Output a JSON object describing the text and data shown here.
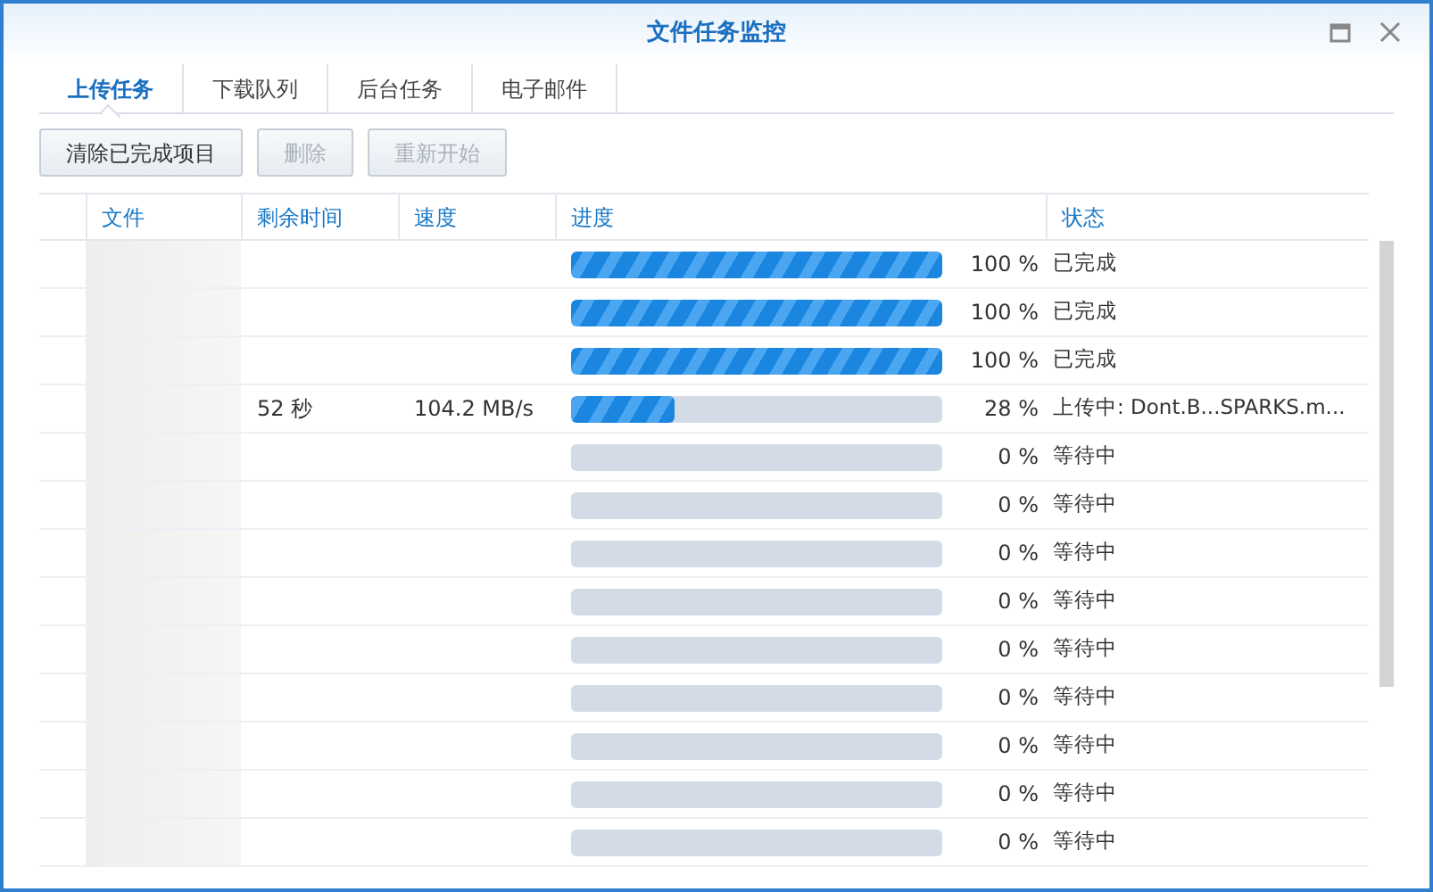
{
  "window": {
    "title": "文件任务监控"
  },
  "tabs": [
    {
      "label": "上传任务",
      "selected": true
    },
    {
      "label": "下载队列",
      "selected": false
    },
    {
      "label": "后台任务",
      "selected": false
    },
    {
      "label": "电子邮件",
      "selected": false
    }
  ],
  "toolbar": [
    {
      "label": "清除已完成项目",
      "disabled": false
    },
    {
      "label": "删除",
      "disabled": true
    },
    {
      "label": "重新开始",
      "disabled": true
    }
  ],
  "table": {
    "columns": [
      "文件",
      "剩余时间",
      "速度",
      "进度",
      "状态"
    ],
    "rows": [
      {
        "time_left": "",
        "speed": "",
        "level": 1,
        "percent": "100 %",
        "status": "已完成"
      },
      {
        "time_left": "",
        "speed": "",
        "level": 1,
        "percent": "100 %",
        "status": "已完成"
      },
      {
        "time_left": "",
        "speed": "",
        "level": 1,
        "percent": "100 %",
        "status": "已完成"
      },
      {
        "time_left": "52 秒",
        "speed": "104.2 MB/s",
        "level": 0.28,
        "percent": "28 %",
        "status": "上传中: Dont.B...SPARKS.m..."
      },
      {
        "time_left": "",
        "speed": "",
        "level": 0,
        "percent": "0 %",
        "status": "等待中"
      },
      {
        "time_left": "",
        "speed": "",
        "level": 0,
        "percent": "0 %",
        "status": "等待中"
      },
      {
        "time_left": "",
        "speed": "",
        "level": 0,
        "percent": "0 %",
        "status": "等待中"
      },
      {
        "time_left": "",
        "speed": "",
        "level": 0,
        "percent": "0 %",
        "status": "等待中"
      },
      {
        "time_left": "",
        "speed": "",
        "level": 0,
        "percent": "0 %",
        "status": "等待中"
      },
      {
        "time_left": "",
        "speed": "",
        "level": 0,
        "percent": "0 %",
        "status": "等待中"
      },
      {
        "time_left": "",
        "speed": "",
        "level": 0,
        "percent": "0 %",
        "status": "等待中"
      },
      {
        "time_left": "",
        "speed": "",
        "level": 0,
        "percent": "0 %",
        "status": "等待中"
      },
      {
        "time_left": "",
        "speed": "",
        "level": 0,
        "percent": "0 %",
        "status": "等待中"
      }
    ]
  }
}
